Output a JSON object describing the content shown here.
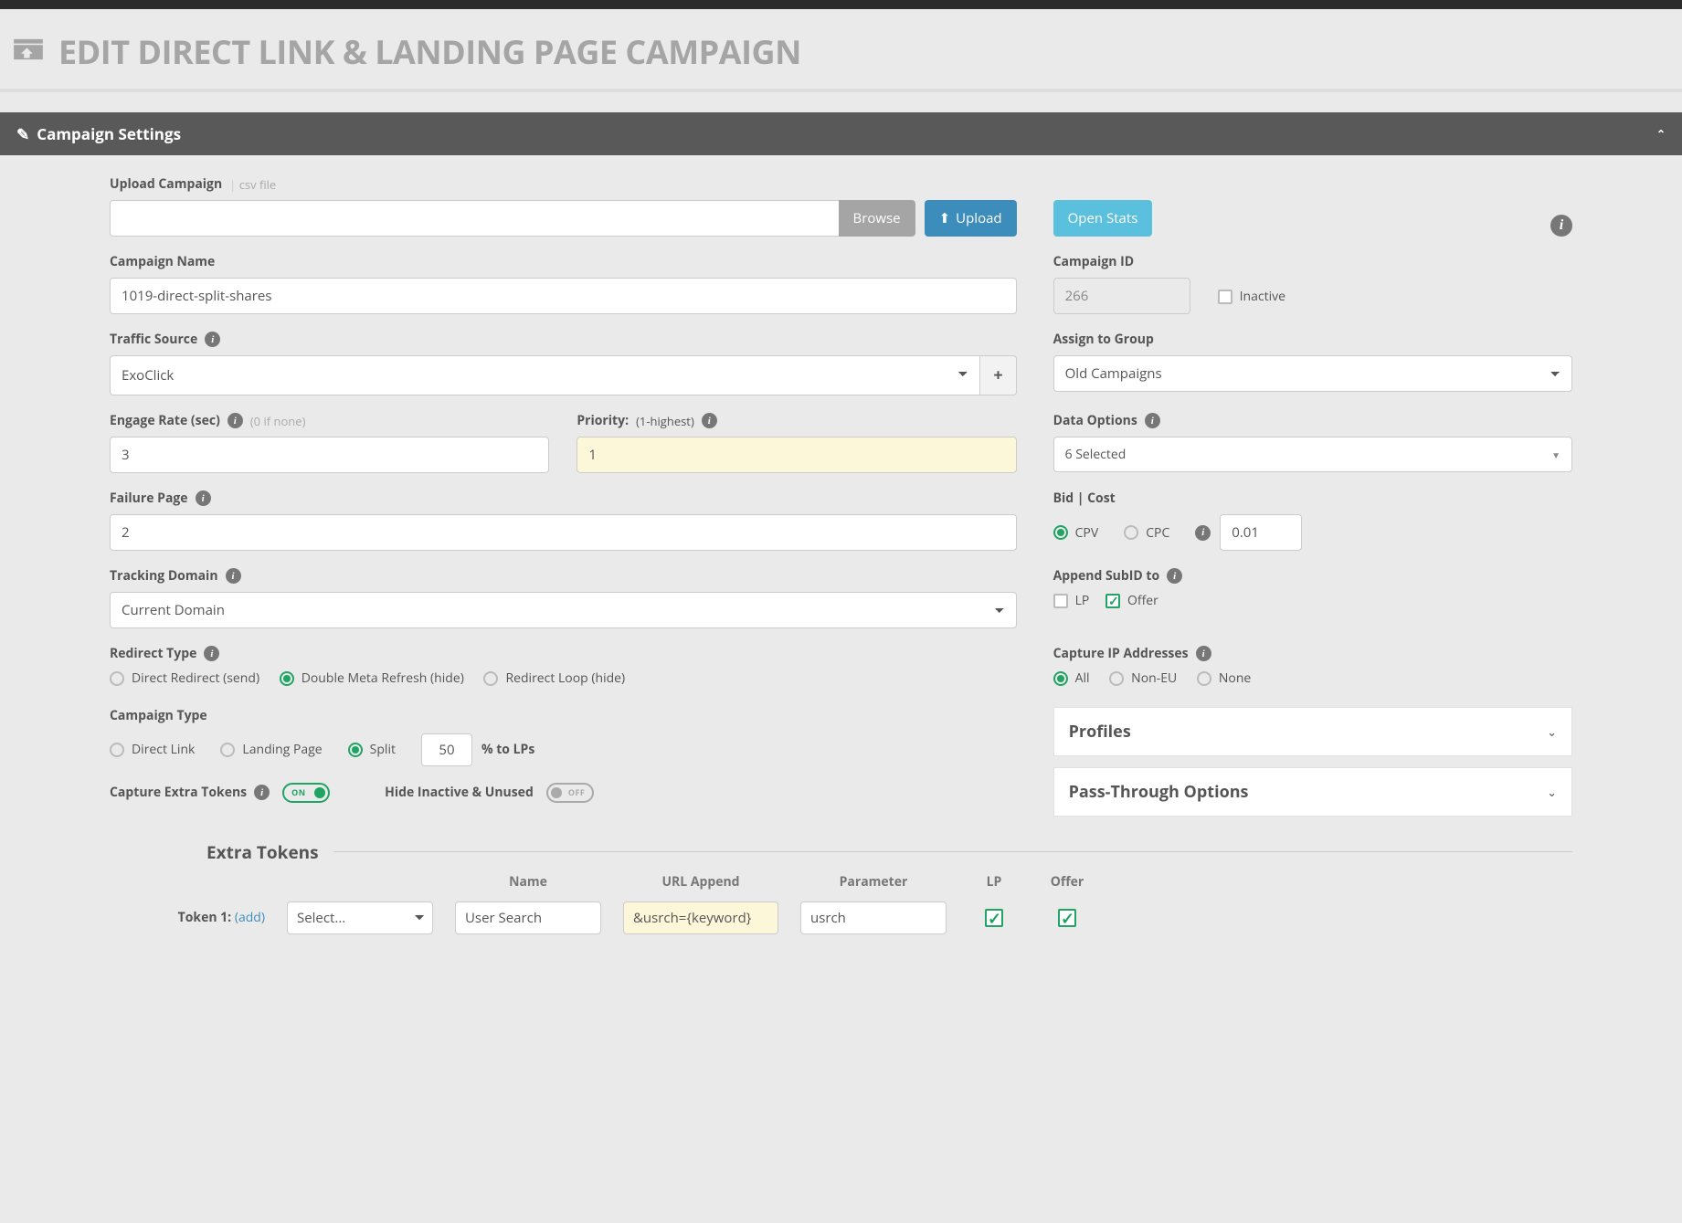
{
  "page_title": "EDIT DIRECT LINK & LANDING PAGE CAMPAIGN",
  "panel_title": "Campaign Settings",
  "upload": {
    "label": "Upload Campaign",
    "sub": "csv file",
    "browse": "Browse",
    "upload": "Upload",
    "stats": "Open Stats"
  },
  "campaign_name": {
    "label": "Campaign Name",
    "value": "1019-direct-split-shares"
  },
  "campaign_id": {
    "label": "Campaign ID",
    "value": "266"
  },
  "inactive_label": "Inactive",
  "traffic_source": {
    "label": "Traffic Source",
    "value": "ExoClick"
  },
  "assign_group": {
    "label": "Assign to Group",
    "value": "Old Campaigns"
  },
  "engage_rate": {
    "label": "Engage Rate (sec)",
    "hint": "(0 if none)",
    "value": "3"
  },
  "priority": {
    "label": "Priority:",
    "hint": "(1-highest)",
    "value": "1"
  },
  "data_options": {
    "label": "Data Options",
    "value": "6 Selected"
  },
  "failure_page": {
    "label": "Failure Page",
    "value": "2"
  },
  "bid": {
    "label": "Bid | Cost",
    "cpv": "CPV",
    "cpc": "CPC",
    "value": "0.01"
  },
  "tracking_domain": {
    "label": "Tracking Domain",
    "value": "Current Domain"
  },
  "append_subid": {
    "label": "Append SubID to",
    "lp": "LP",
    "offer": "Offer"
  },
  "redirect_type": {
    "label": "Redirect Type",
    "direct": "Direct Redirect (send)",
    "meta": "Double Meta Refresh (hide)",
    "loop": "Redirect Loop (hide)"
  },
  "capture_ip": {
    "label": "Capture IP Addresses",
    "all": "All",
    "noneu": "Non-EU",
    "none": "None"
  },
  "campaign_type": {
    "label": "Campaign Type",
    "direct": "Direct Link",
    "lp": "Landing Page",
    "split": "Split",
    "pct": "50",
    "pct_label": "% to LPs"
  },
  "capture_extra": {
    "label": "Capture Extra Tokens",
    "on": "ON"
  },
  "hide_inactive": {
    "label": "Hide Inactive & Unused",
    "off": "OFF"
  },
  "profiles": "Profiles",
  "passthrough": "Pass-Through Options",
  "extra_tokens": {
    "title": "Extra Tokens",
    "hd_name": "Name",
    "hd_append": "URL Append",
    "hd_param": "Parameter",
    "hd_lp": "LP",
    "hd_offer": "Offer",
    "token1_label": "Token 1:",
    "add": "(add)",
    "select": "Select...",
    "name": "User Search",
    "append": "&usrch={keyword}",
    "param": "usrch"
  }
}
